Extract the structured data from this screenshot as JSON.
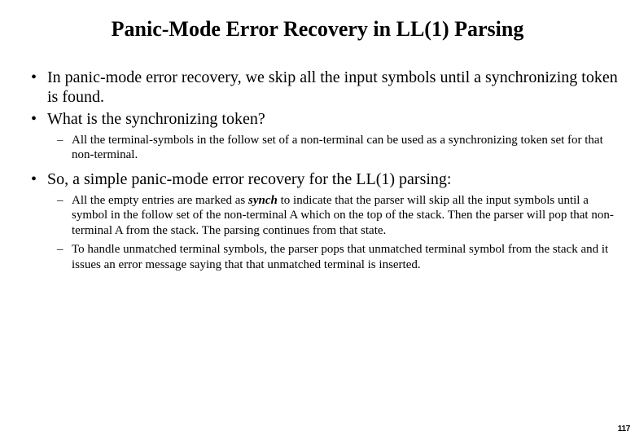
{
  "title": "Panic-Mode Error Recovery in LL(1) Parsing",
  "bullets": {
    "b1": "In panic-mode error recovery, we skip all the input symbols until a synchronizing token is found.",
    "b2": "What is the synchronizing token?",
    "b2_sub1": "All the terminal-symbols in the follow set of a non-terminal can be used as a synchronizing token set for that non-terminal.",
    "b3": " So, a simple panic-mode error recovery for the LL(1) parsing:",
    "b3_sub1_pre": "All the empty entries are marked as ",
    "b3_sub1_em": "synch",
    "b3_sub1_post": " to indicate that the parser will skip all the input symbols until a symbol in the follow set of the non-terminal A which on the top of the stack. Then the parser will pop that non-terminal A from the stack. The parsing continues from that state.",
    "b3_sub2": "To handle unmatched terminal symbols, the parser pops that unmatched terminal symbol from the stack and it issues an error message saying that that unmatched terminal is inserted."
  },
  "page_number": "117"
}
